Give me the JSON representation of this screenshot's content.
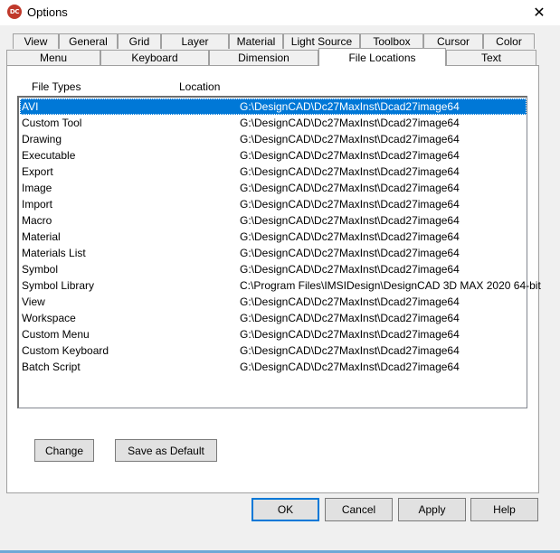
{
  "window": {
    "title": "Options",
    "app_icon_text": "DC",
    "close_symbol": "✕"
  },
  "tabs_back": [
    {
      "label": "View"
    },
    {
      "label": "General"
    },
    {
      "label": "Grid"
    },
    {
      "label": "Layer"
    },
    {
      "label": "Material"
    },
    {
      "label": "Light Source"
    },
    {
      "label": "Toolbox"
    },
    {
      "label": "Cursor"
    },
    {
      "label": "Color"
    }
  ],
  "tabs_front": [
    {
      "label": "Menu"
    },
    {
      "label": "Keyboard"
    },
    {
      "label": "Dimension"
    },
    {
      "label": "File Locations",
      "active": true
    },
    {
      "label": "Text"
    }
  ],
  "list": {
    "col_file_types": "File Types",
    "col_location": "Location",
    "rows": [
      {
        "name": "AVI",
        "location": "G:\\DesignCAD\\Dc27MaxInst\\Dcad27image64",
        "selected": true
      },
      {
        "name": "Custom Tool",
        "location": "G:\\DesignCAD\\Dc27MaxInst\\Dcad27image64"
      },
      {
        "name": "Drawing",
        "location": "G:\\DesignCAD\\Dc27MaxInst\\Dcad27image64"
      },
      {
        "name": "Executable",
        "location": "G:\\DesignCAD\\Dc27MaxInst\\Dcad27image64"
      },
      {
        "name": "Export",
        "location": "G:\\DesignCAD\\Dc27MaxInst\\Dcad27image64"
      },
      {
        "name": "Image",
        "location": "G:\\DesignCAD\\Dc27MaxInst\\Dcad27image64"
      },
      {
        "name": "Import",
        "location": "G:\\DesignCAD\\Dc27MaxInst\\Dcad27image64"
      },
      {
        "name": "Macro",
        "location": "G:\\DesignCAD\\Dc27MaxInst\\Dcad27image64"
      },
      {
        "name": "Material",
        "location": "G:\\DesignCAD\\Dc27MaxInst\\Dcad27image64"
      },
      {
        "name": "Materials List",
        "location": "G:\\DesignCAD\\Dc27MaxInst\\Dcad27image64"
      },
      {
        "name": "Symbol",
        "location": "G:\\DesignCAD\\Dc27MaxInst\\Dcad27image64"
      },
      {
        "name": "Symbol Library",
        "location": "C:\\Program Files\\IMSIDesign\\DesignCAD 3D MAX 2020 64-bit"
      },
      {
        "name": "View",
        "location": "G:\\DesignCAD\\Dc27MaxInst\\Dcad27image64"
      },
      {
        "name": "Workspace",
        "location": "G:\\DesignCAD\\Dc27MaxInst\\Dcad27image64"
      },
      {
        "name": "Custom Menu",
        "location": "G:\\DesignCAD\\Dc27MaxInst\\Dcad27image64"
      },
      {
        "name": "Custom Keyboard",
        "location": "G:\\DesignCAD\\Dc27MaxInst\\Dcad27image64"
      },
      {
        "name": "Batch Script",
        "location": "G:\\DesignCAD\\Dc27MaxInst\\Dcad27image64"
      }
    ]
  },
  "panel_buttons": {
    "change": "Change",
    "save_default": "Save as Default"
  },
  "dialog_buttons": {
    "ok": "OK",
    "cancel": "Cancel",
    "apply": "Apply",
    "help": "Help"
  },
  "colors": {
    "selection": "#0078d7",
    "app_icon": "#c0392b"
  }
}
